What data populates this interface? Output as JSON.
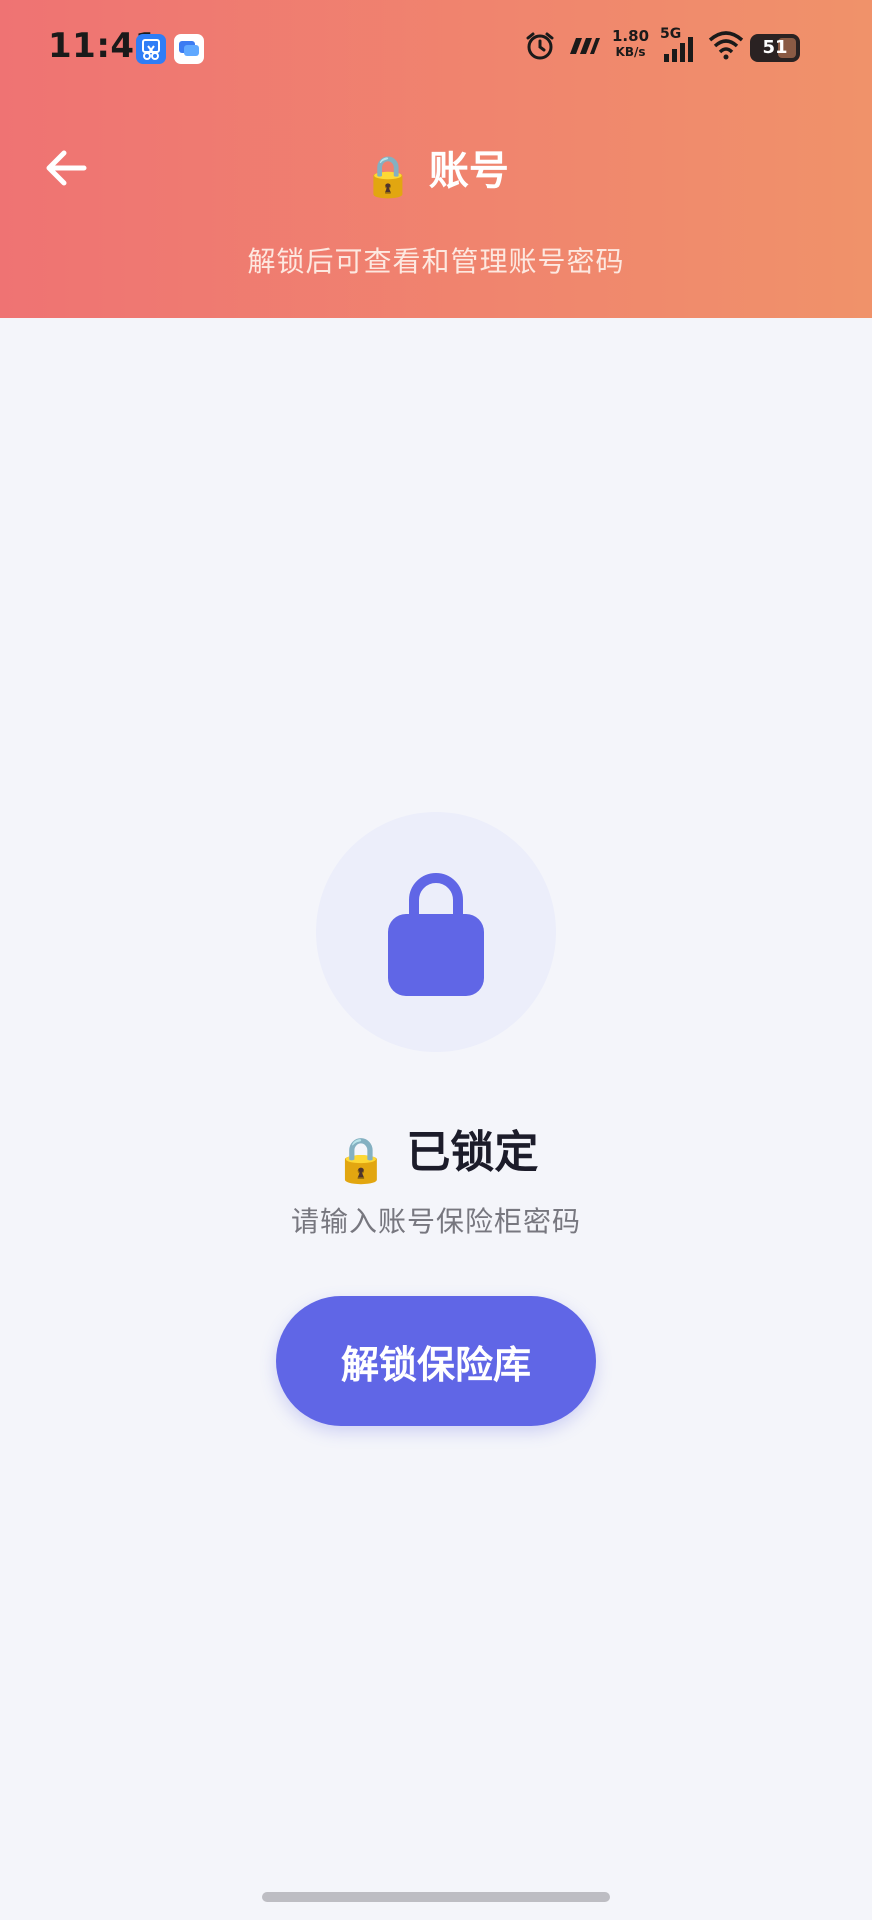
{
  "status_bar": {
    "time": "11:41",
    "net_speed_value": "1.80",
    "net_speed_unit": "KB/s",
    "network_type": "5G",
    "battery_level": "51",
    "icons": [
      "app-scissors-icon",
      "app-message-icon",
      "alarm-icon",
      "nfc-icon",
      "signal-icon",
      "wifi-icon",
      "battery-icon"
    ]
  },
  "header": {
    "back_icon": "arrow-left-icon",
    "title_emoji": "🔒",
    "title": "账号",
    "subtitle": "解锁后可查看和管理账号密码"
  },
  "locked_panel": {
    "lock_icon": "lock-icon",
    "title_emoji": "🔒",
    "title": "已锁定",
    "subtitle": "请输入账号保险柜密码",
    "unlock_button_label": "解锁保险库"
  },
  "colors": {
    "header_gradient_start": "#ef7373",
    "header_gradient_end": "#f0926a",
    "accent": "#6066e6",
    "lock_circle_bg": "#eceefa",
    "page_bg": "#f4f5fa"
  }
}
